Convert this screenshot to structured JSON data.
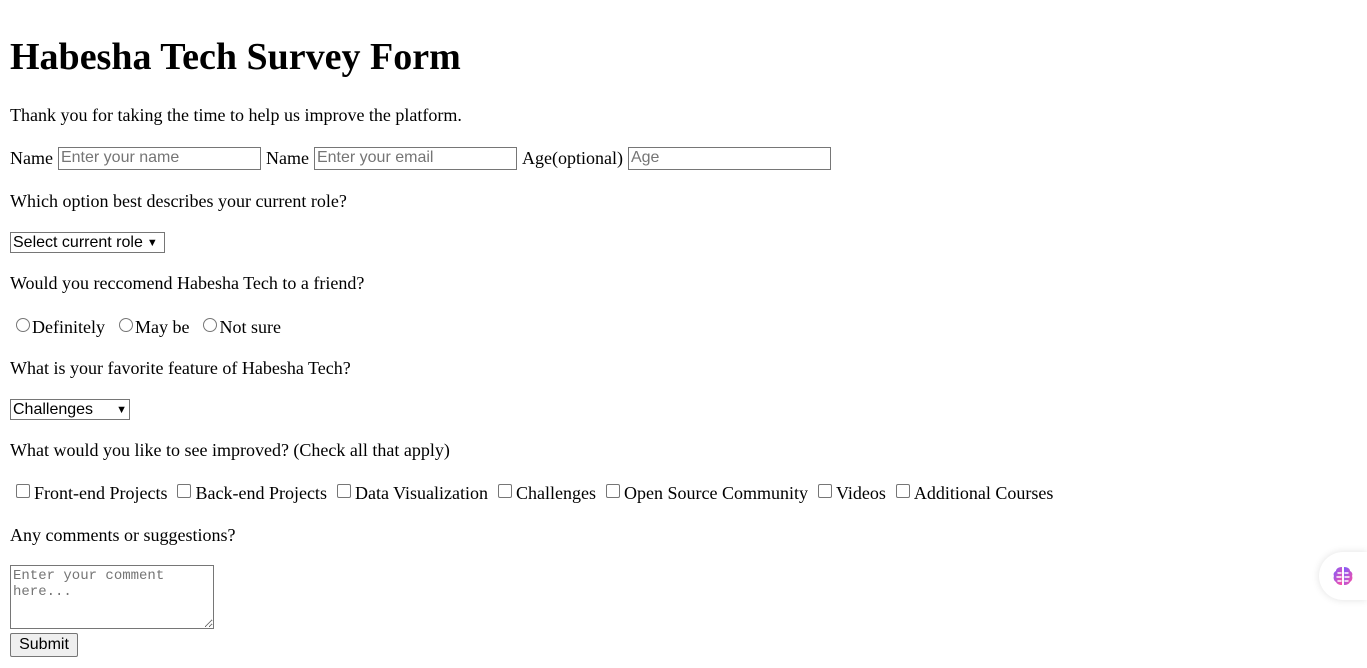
{
  "title": "Habesha Tech Survey Form",
  "intro": "Thank you for taking the time to help us improve the platform.",
  "inputs": {
    "name_label": "Name",
    "name_placeholder": "Enter your name",
    "email_label": "Name",
    "email_placeholder": "Enter your email",
    "age_label": "Age(optional)",
    "age_placeholder": "Age"
  },
  "role": {
    "question": "Which option best describes your current role?",
    "selected": "Select current role"
  },
  "recommend": {
    "question": "Would you reccomend Habesha Tech to a friend?",
    "options": [
      "Definitely",
      "May be",
      "Not sure"
    ]
  },
  "feature": {
    "question": "What is your favorite feature of Habesha Tech?",
    "selected": "Challenges"
  },
  "improve": {
    "question": "What would you like to see improved? (Check all that apply)",
    "options": [
      "Front-end Projects",
      "Back-end Projects",
      "Data Visualization",
      "Challenges",
      "Open Source Community",
      "Videos",
      "Additional Courses"
    ]
  },
  "comments": {
    "question": "Any comments or suggestions?",
    "placeholder": "Enter your comment here..."
  },
  "submit_label": "Submit",
  "floating_icon": "brain-icon"
}
